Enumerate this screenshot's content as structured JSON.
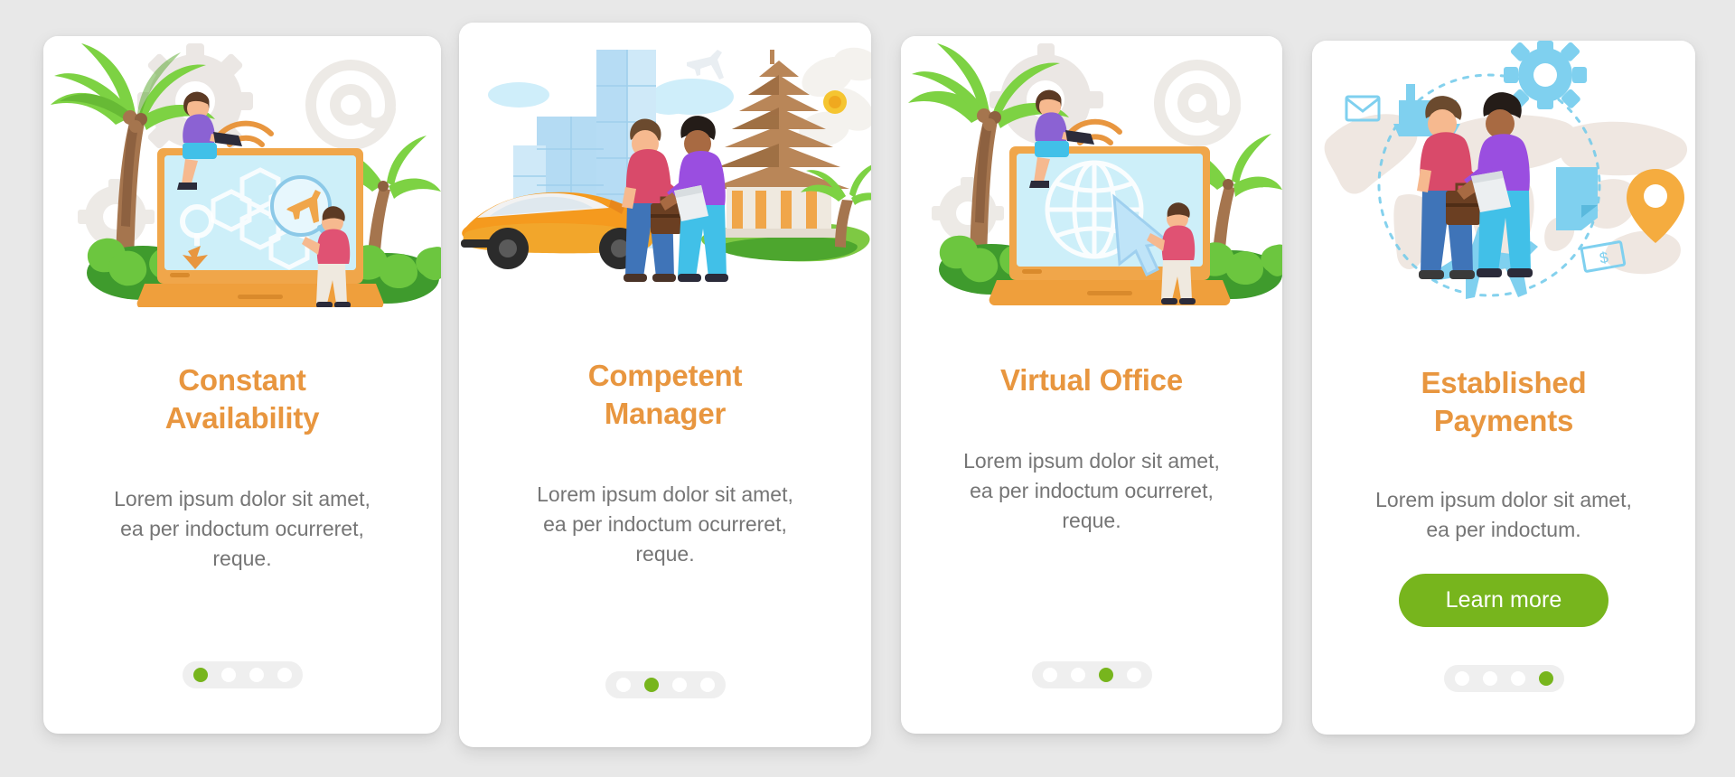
{
  "page": {
    "background_color": "#e8e8e8",
    "card_background": "#ffffff",
    "accent_orange": "#e8963f",
    "accent_green": "#77b51d",
    "body_text_color": "#757575",
    "dots_track_color": "#efefef"
  },
  "cards": [
    {
      "title": "Constant Availability",
      "description": "Lorem ipsum dolor sit amet, ea per indoctum ocurreret, reque.",
      "illustration": "tropical-laptop-flight-search-illustration",
      "pagination": {
        "count": 4,
        "active_index": 0
      },
      "cta": null
    },
    {
      "title": "Competent Manager",
      "description": "Lorem ipsum dolor sit amet, ea per indoctum ocurreret, reque.",
      "illustration": "handshake-car-city-temple-illustration",
      "pagination": {
        "count": 4,
        "active_index": 1
      },
      "cta": null
    },
    {
      "title": "Virtual Office",
      "description": "Lorem ipsum dolor sit amet, ea per indoctum ocurreret, reque.",
      "illustration": "tropical-laptop-globe-cursor-illustration",
      "pagination": {
        "count": 4,
        "active_index": 2
      },
      "cta": null
    },
    {
      "title": "Established Payments",
      "description": "Lorem ipsum dolor sit amet, ea per indoctum.",
      "illustration": "world-map-handshake-payments-illustration",
      "pagination": {
        "count": 4,
        "active_index": 3
      },
      "cta": "Learn more"
    }
  ]
}
